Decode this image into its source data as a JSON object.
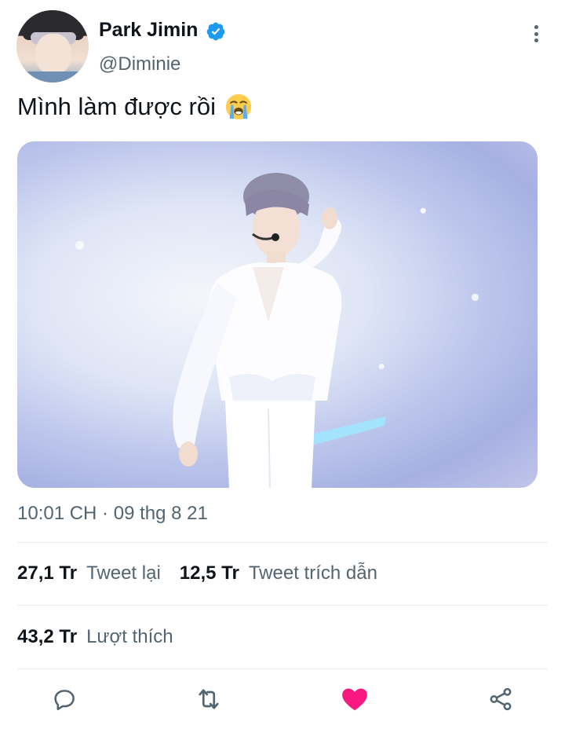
{
  "author": {
    "name": "Park Jimin",
    "handle": "@Diminie",
    "verified": true,
    "avatar_icon": "avatar-photo"
  },
  "tweet": {
    "text": "Mình làm được rồi",
    "emoji_icon": "loudly-crying-face-icon",
    "media_icon": "concert-photo-performer",
    "media_watermark": "",
    "timestamp": "10:01 CH · 09 thg 8 21"
  },
  "stats": {
    "retweets": {
      "count": "27,1 Tr",
      "label": "Tweet lại"
    },
    "quotes": {
      "count": "12,5 Tr",
      "label": "Tweet trích dẫn"
    },
    "likes": {
      "count": "43,2 Tr",
      "label": "Lượt thích"
    }
  },
  "actions": {
    "reply_icon": "reply-bubble-icon",
    "retweet_icon": "retweet-icon",
    "like_icon": "heart-filled-icon",
    "share_icon": "share-icon"
  },
  "colors": {
    "verified": "#1d9bf0",
    "like": "#f91880",
    "muted": "#536471",
    "text": "#0f1419"
  }
}
